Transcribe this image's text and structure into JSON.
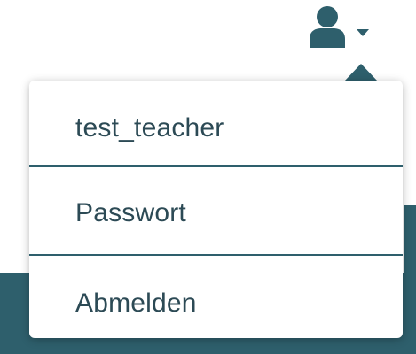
{
  "user_menu": {
    "trigger_icon": "user-icon",
    "caret_icon": "caret-down-icon",
    "items": [
      {
        "label": "test_teacher"
      },
      {
        "label": "Passwort"
      },
      {
        "label": "Abmelden"
      }
    ]
  },
  "colors": {
    "accent": "#2e5f6c",
    "text": "#2c4a55",
    "background": "#ffffff"
  }
}
